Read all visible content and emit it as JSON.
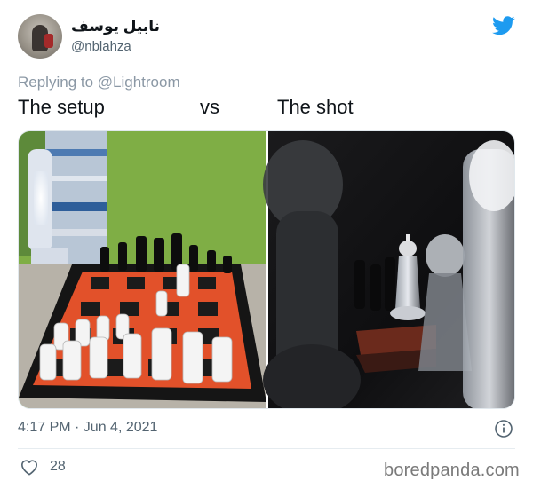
{
  "tweet": {
    "display_name": "نابيل يوسف",
    "handle": "@nblahza",
    "reply_to": "Replying to @Lightroom",
    "text_left": "The setup",
    "text_middle": "vs",
    "text_right": "The shot",
    "timestamp": "4:17 PM · Jun 4, 2021",
    "like_count": "28"
  },
  "icons": {
    "brand": "twitter-bird-icon",
    "info": "info-icon",
    "like": "heart-icon"
  },
  "media": {
    "left_image": "chess board setup with desk lamp",
    "right_image": "dramatic low-light chess photo"
  },
  "watermark": "boredpanda.com",
  "colors": {
    "twitter_blue": "#1d9bf0",
    "secondary_text": "#536471",
    "chess_orange": "#e2512a"
  }
}
